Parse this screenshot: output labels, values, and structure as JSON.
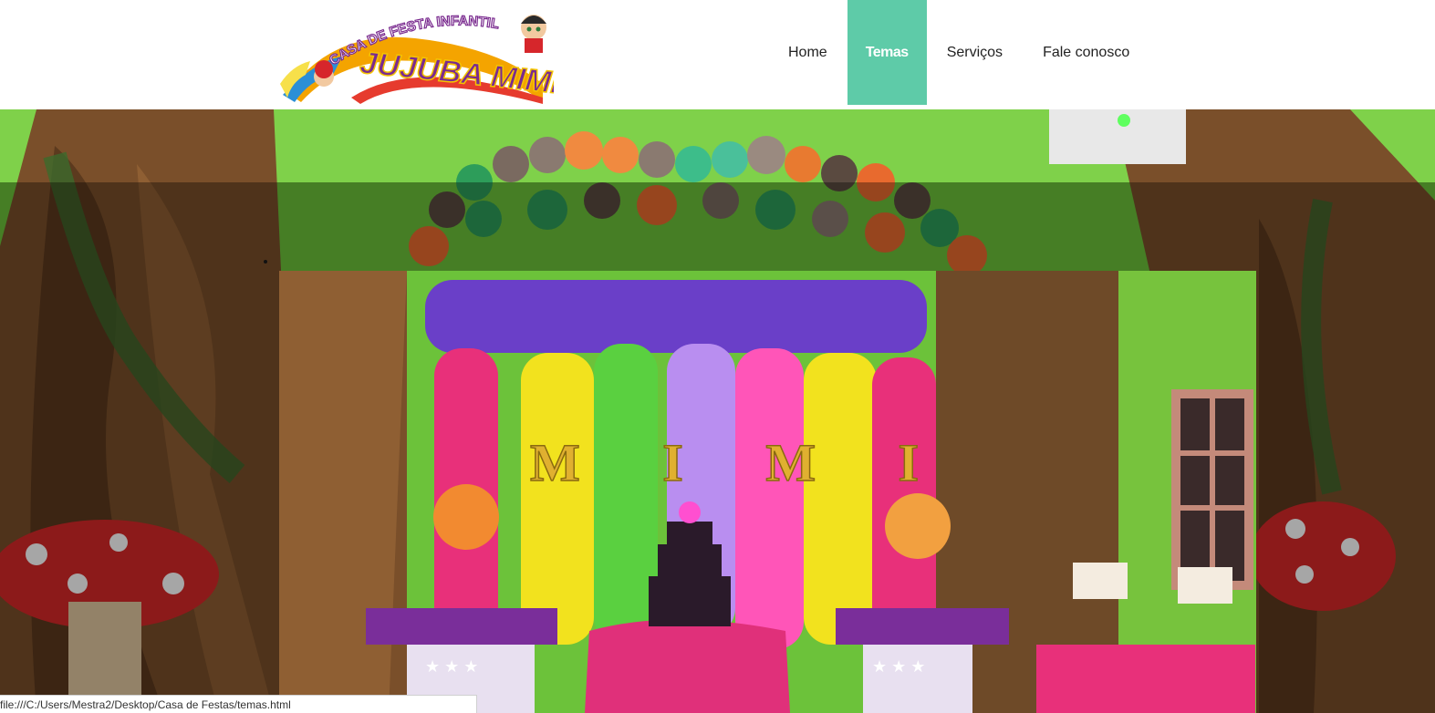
{
  "logo": {
    "alt_text": "Casa de Festa Infantil Jujuba Mimi",
    "line1": "CASA DE FESTA INFANTIL",
    "line2": "JUJUBA MIMI"
  },
  "nav": {
    "items": [
      {
        "label": "Home",
        "active": false
      },
      {
        "label": "Temas",
        "active": true
      },
      {
        "label": "Serviços",
        "active": false
      },
      {
        "label": "Fale conosco",
        "active": false
      }
    ]
  },
  "hero": {
    "slide_letters": "M I M I"
  },
  "status_bar": {
    "url": "file:///C:/Users/Mestra2/Desktop/Casa de Festas/temas.html"
  },
  "colors": {
    "accent": "#5ecba8",
    "wall_green": "#6cc23a"
  }
}
